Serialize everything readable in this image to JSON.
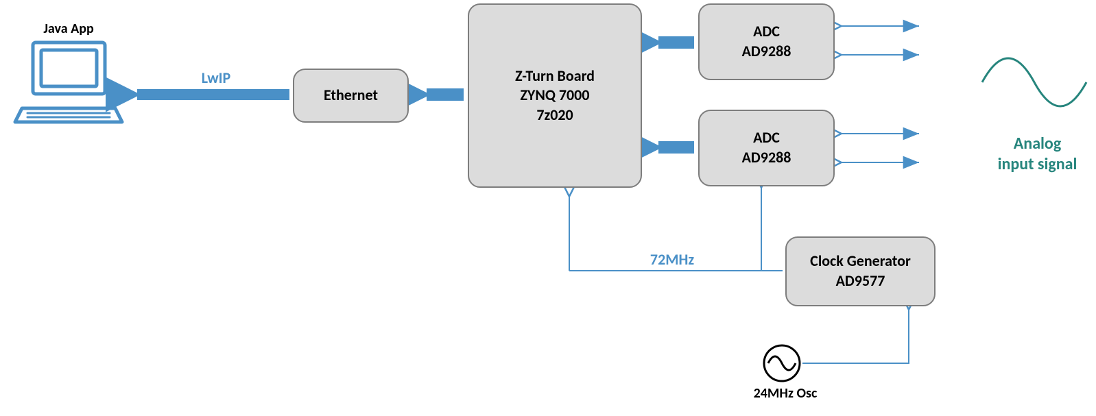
{
  "labels": {
    "java_app": "Java App",
    "lwip": "LwIP",
    "ethernet": "Ethernet",
    "zturn_l1": "Z-Turn Board",
    "zturn_l2": "ZYNQ 7000",
    "zturn_l3": "7z020",
    "adc_top_l1": "ADC",
    "adc_top_l2": "AD9288",
    "adc_bot_l1": "ADC",
    "adc_bot_l2": "AD9288",
    "clkgen_l1": "Clock Generator",
    "clkgen_l2": "AD9577",
    "clk_72": "72MHz",
    "osc_24": "24MHz Osc",
    "analog_l1": "Analog",
    "analog_l2": "input signal"
  },
  "colors": {
    "box_fill": "#dcdcdc",
    "box_border": "#7d7d7d",
    "arrow_blue": "#4a90c7",
    "label_blue": "#4a90c7",
    "label_teal": "#26857d",
    "black": "#000000"
  }
}
